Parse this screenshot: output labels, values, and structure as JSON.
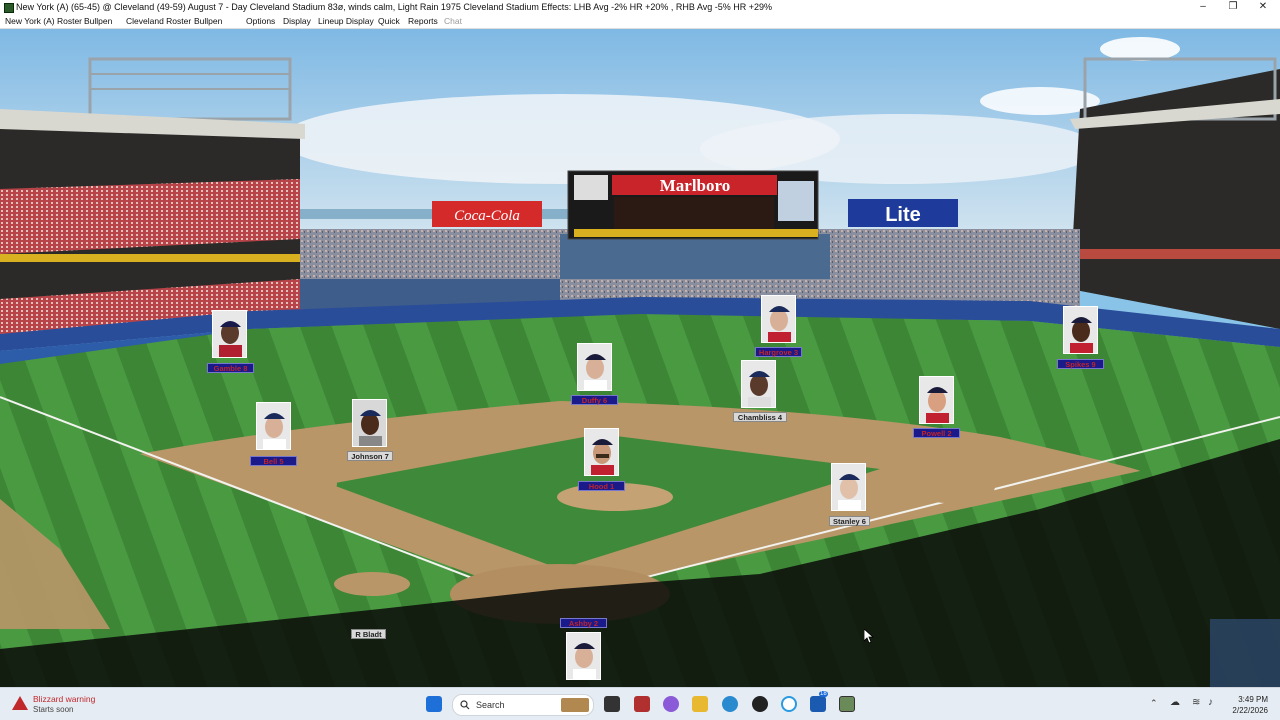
{
  "window": {
    "title": "New York (A) (65-45) @  Cleveland (49-59)  August 7 - Day     Cleveland Stadium   83ø, winds calm, Light Rain      1975 Cleveland Stadium Effects: LHB Avg -2%  HR +20% , RHB Avg -5%  HR +29%"
  },
  "menu": {
    "items": [
      "New York (A) Roster",
      "Bullpen",
      "Cleveland Roster",
      "Bullpen",
      "Options",
      "Display",
      "Lineup Display",
      "Quick",
      "Reports",
      "Chat"
    ]
  },
  "field": {
    "billboards": [
      "Coca-Cola",
      "Marlboro",
      "Lite"
    ],
    "umpire_label": "R Bladt",
    "players": [
      {
        "name": "Gamble 8",
        "team": "home"
      },
      {
        "name": "Hargrove 3",
        "team": "home"
      },
      {
        "name": "Spikes 9",
        "team": "home"
      },
      {
        "name": "Bell 5",
        "team": "home"
      },
      {
        "name": "Johnson 7",
        "team": "away"
      },
      {
        "name": "Duffy 6",
        "team": "home"
      },
      {
        "name": "Chambliss 4",
        "team": "away"
      },
      {
        "name": "Powell 2",
        "team": "home"
      },
      {
        "name": "Hood 1",
        "team": "home"
      },
      {
        "name": "Stanley 6",
        "team": "away"
      },
      {
        "name": "Ashby 2",
        "team": "home"
      }
    ]
  },
  "taskbar": {
    "notification_title": "Blizzard warning",
    "notification_sub": "Starts soon",
    "search_label": "Search",
    "time": "3:49 PM",
    "date": "2/22/2026",
    "badge_count": "18"
  }
}
